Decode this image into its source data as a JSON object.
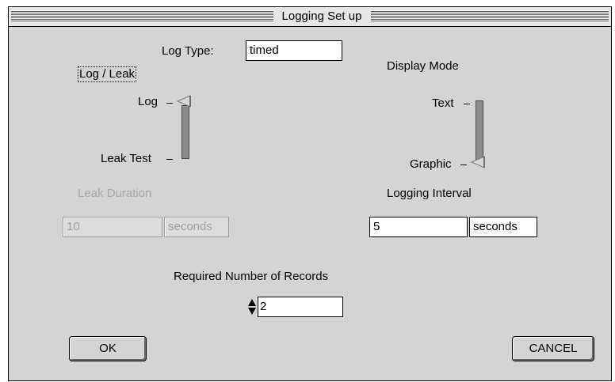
{
  "window": {
    "title": "Logging Set up"
  },
  "log_type": {
    "label": "Log Type:",
    "value": "timed"
  },
  "log_leak": {
    "group_label": "Log / Leak",
    "options": [
      "Log",
      "Leak Test"
    ],
    "selected": "Log"
  },
  "display_mode": {
    "label": "Display Mode",
    "options": [
      "Text",
      "Graphic"
    ],
    "selected": "Graphic"
  },
  "leak_duration": {
    "label": "Leak Duration",
    "value": "10",
    "unit": "seconds"
  },
  "logging_interval": {
    "label": "Logging Interval",
    "value": "5",
    "unit": "seconds"
  },
  "records": {
    "label": "Required Number of Records",
    "value": "2"
  },
  "buttons": {
    "ok": "OK",
    "cancel": "CANCEL"
  }
}
